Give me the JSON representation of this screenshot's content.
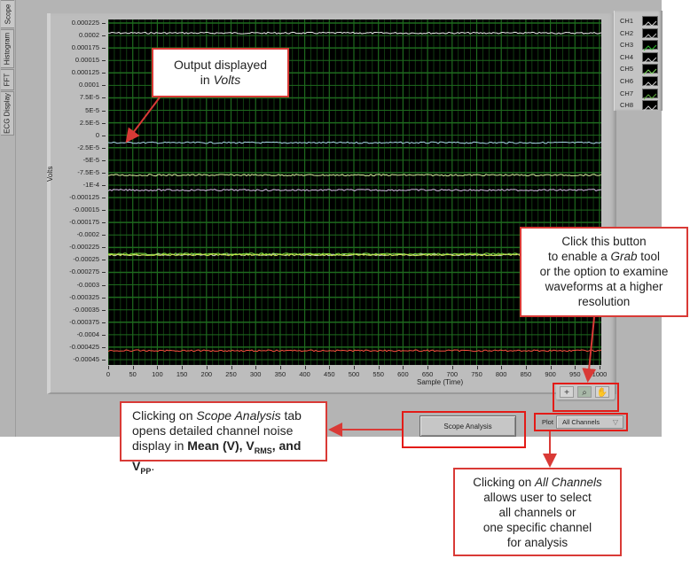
{
  "tabs": [
    {
      "label": "Scope",
      "active": true
    },
    {
      "label": "Histogram",
      "active": false
    },
    {
      "label": "FFT",
      "active": false
    },
    {
      "label": "ECG Display",
      "active": false
    }
  ],
  "graph": {
    "y_axis_title": "Volts",
    "x_axis_title": "Sample (Time)",
    "y_ticks": [
      "0.000225",
      "0.0002",
      "0.000175",
      "0.00015",
      "0.000125",
      "0.0001",
      "7.5E-5",
      "5E-5",
      "2.5E-5",
      "0",
      "-2.5E-5",
      "-5E-5",
      "-7.5E-5",
      "-1E-4",
      "-0.000125",
      "-0.00015",
      "-0.000175",
      "-0.0002",
      "-0.000225",
      "-0.00025",
      "-0.000275",
      "-0.0003",
      "-0.000325",
      "-0.00035",
      "-0.000375",
      "-0.0004",
      "-0.000425",
      "-0.00045"
    ],
    "x_ticks": [
      "0",
      "50",
      "100",
      "150",
      "200",
      "250",
      "300",
      "350",
      "400",
      "450",
      "500",
      "550",
      "600",
      "650",
      "700",
      "750",
      "800",
      "850",
      "900",
      "950",
      "1000"
    ],
    "background_color": "#000000",
    "grid_color": "#1e6a1e"
  },
  "chart_data": {
    "type": "line",
    "title": "",
    "xlabel": "Sample (Time)",
    "ylabel": "Volts",
    "xlim": [
      0,
      1000
    ],
    "ylim": [
      -0.00045,
      0.000225
    ],
    "grid": true,
    "legend_position": "top-right",
    "series": [
      {
        "name": "CH1",
        "level": 0.000205,
        "color": "#e8e8e8"
      },
      {
        "name": "CH2",
        "level": -1.5e-05,
        "color": "#a8d8e8"
      },
      {
        "name": "CH3",
        "level": -8e-05,
        "color": "#d8f0a0"
      },
      {
        "name": "CH4",
        "level": -0.00011,
        "color": "#d8c0e8"
      },
      {
        "name": "CH5",
        "level": -0.000238,
        "color": "#7ae03a"
      },
      {
        "name": "CH6",
        "level": -0.00024,
        "color": "#c8c8c8"
      },
      {
        "name": "CH7",
        "level": -0.00024,
        "color": "#c0e040"
      },
      {
        "name": "CH8",
        "level": -0.000432,
        "color": "#ff5040"
      }
    ]
  },
  "legend": {
    "items": [
      {
        "label": "CH1",
        "color": "#cfcfcf"
      },
      {
        "label": "CH2",
        "color": "#bfbfbf"
      },
      {
        "label": "CH3",
        "color": "#2fbf2f"
      },
      {
        "label": "CH4",
        "color": "#cfcfcf"
      },
      {
        "label": "CH5",
        "color": "#7fdc5f"
      },
      {
        "label": "CH6",
        "color": "#cfcfcf"
      },
      {
        "label": "CH7",
        "color": "#5faf3f"
      },
      {
        "label": "CH8",
        "color": "#cfcfcf"
      }
    ]
  },
  "tools": [
    {
      "name": "cursor-tool",
      "glyph": "+"
    },
    {
      "name": "zoom-tool",
      "glyph": "⌕"
    },
    {
      "name": "grab-tool",
      "glyph": "✋"
    }
  ],
  "controls": {
    "scope_analysis_label": "Scope Analysis",
    "plot_label": "Plot",
    "plot_selected": "All Channels"
  },
  "annotations": {
    "volts": {
      "line1": "Output displayed",
      "line2_pre": "in ",
      "line2_em": "Volts"
    },
    "grab": {
      "l1": "Click this button",
      "l2_pre": "to enable a ",
      "l2_em": "Grab",
      "l2_post": " tool",
      "l3": "or the option to examine",
      "l4": "waveforms at a higher",
      "l5": "resolution"
    },
    "scope": {
      "l1_pre": "Clicking on ",
      "l1_em": "Scope Analysis",
      "l1_post": " tab",
      "l2": "opens detailed channel noise",
      "l3_pre": "display in ",
      "l3_b1": "Mean (V), V",
      "l3_sub1": "RMS",
      "l3_b2": ", and V",
      "l3_sub2": "PP",
      "l3_post": "."
    },
    "channels": {
      "l1_pre": "Clicking on ",
      "l1_em": "All Channels",
      "l2": "allows user to select",
      "l3": "all channels or",
      "l4": "one specific channel",
      "l5": "for analysis"
    },
    "accent_color": "#d93a36"
  }
}
